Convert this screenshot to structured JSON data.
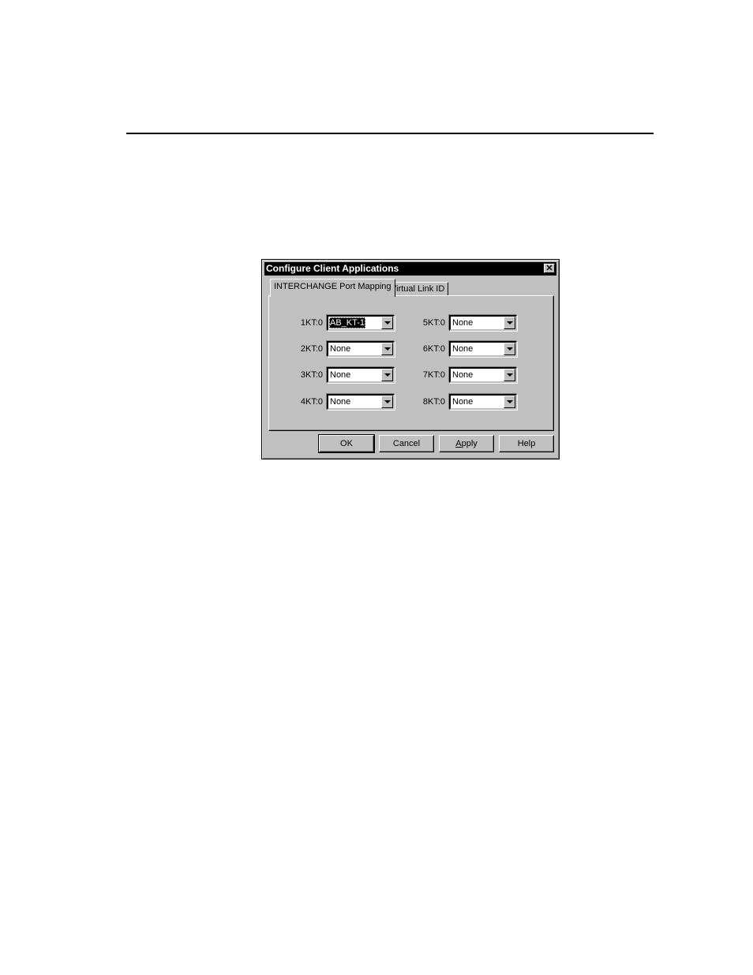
{
  "dialog": {
    "title": "Configure Client Applications",
    "close_icon": "close-icon"
  },
  "tabs": [
    {
      "label": "INTERCHANGE Port Mapping",
      "active": true
    },
    {
      "label": "Virtual Link ID",
      "active": false
    }
  ],
  "ports": [
    {
      "label": "1KT:0",
      "value": "AB_KT-1",
      "selected": true
    },
    {
      "label": "2KT:0",
      "value": "None"
    },
    {
      "label": "3KT:0",
      "value": "None"
    },
    {
      "label": "4KT:0",
      "value": "None"
    },
    {
      "label": "5KT:0",
      "value": "None"
    },
    {
      "label": "6KT:0",
      "value": "None"
    },
    {
      "label": "7KT:0",
      "value": "None"
    },
    {
      "label": "8KT:0",
      "value": "None"
    }
  ],
  "buttons": {
    "ok": "OK",
    "cancel": "Cancel",
    "apply_accel": "A",
    "apply_rest": "pply",
    "help": "Help"
  }
}
